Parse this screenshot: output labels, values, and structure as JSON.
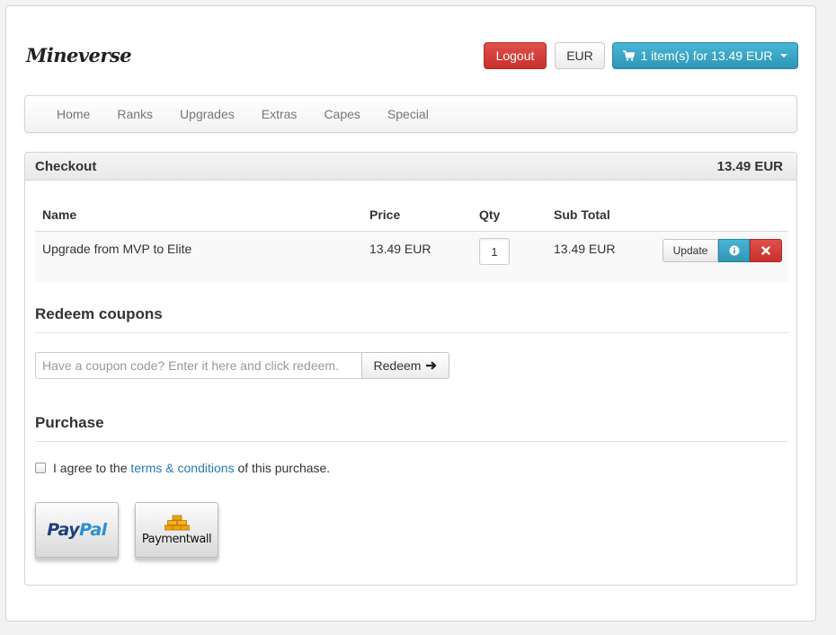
{
  "header": {
    "logo_text": "Mineverse",
    "logout_label": "Logout",
    "currency_label": "EUR",
    "cart_label": "1 item(s) for 13.49 EUR"
  },
  "nav": {
    "items": [
      {
        "label": "Home"
      },
      {
        "label": "Ranks"
      },
      {
        "label": "Upgrades"
      },
      {
        "label": "Extras"
      },
      {
        "label": "Capes"
      },
      {
        "label": "Special"
      }
    ]
  },
  "checkout": {
    "title": "Checkout",
    "total": "13.49 EUR",
    "columns": [
      "Name",
      "Price",
      "Qty",
      "Sub Total"
    ],
    "rows": [
      {
        "name": "Upgrade from MVP to Elite",
        "price": "13.49 EUR",
        "qty": "1",
        "subtotal": "13.49 EUR",
        "update_label": "Update"
      }
    ]
  },
  "coupons": {
    "title": "Redeem coupons",
    "placeholder": "Have a coupon code? Enter it here and click redeem.",
    "redeem_label": "Redeem"
  },
  "purchase": {
    "title": "Purchase",
    "agree_prefix": "I agree to the",
    "terms_link": "terms & conditions",
    "agree_suffix": "of this purchase.",
    "paypal_part1": "Pay",
    "paypal_part2": "Pal",
    "paymentwall_label": "Paymentwall"
  },
  "colors": {
    "danger": "#c9302c",
    "info": "#2f96b4",
    "link": "#2a7ab0"
  }
}
